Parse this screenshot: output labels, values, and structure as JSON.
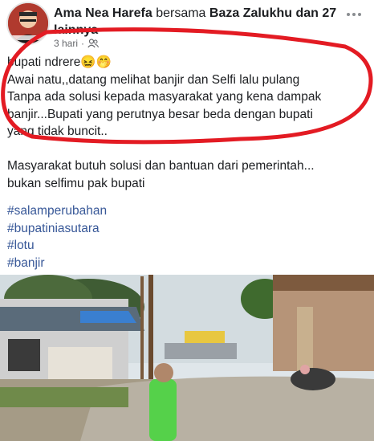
{
  "header": {
    "author": "Ama Nea Harefa",
    "with_text": "bersama",
    "tagged": "Baza Zalukhu dan 27 lainnya",
    "time": "3 hari",
    "separator": "·",
    "audience_icon": "friends-icon",
    "more_icon": "more-options-icon"
  },
  "post": {
    "lines": [
      "bupati ndrere😖🤭",
      "Awai natu,,datang melihat banjir dan Selfi lalu pulang",
      "Tanpa ada solusi kepada masyarakat yang kena dampak",
      "banjir...Bupati yang perutnya besar beda dengan bupati",
      "yang tidak buncit..",
      "",
      "Masyarakat butuh solusi dan bantuan dari pemerintah...",
      "bukan selfimu pak bupati"
    ],
    "hashtags": [
      "#salamperubahan",
      "#bupatiniasutara",
      "#lotu",
      "#banjir"
    ]
  },
  "colors": {
    "hashtag": "#385898",
    "annotation_circle": "#e31b23",
    "meta": "#65676b"
  },
  "photo": {
    "description_icon": "flooded-street-photo"
  }
}
